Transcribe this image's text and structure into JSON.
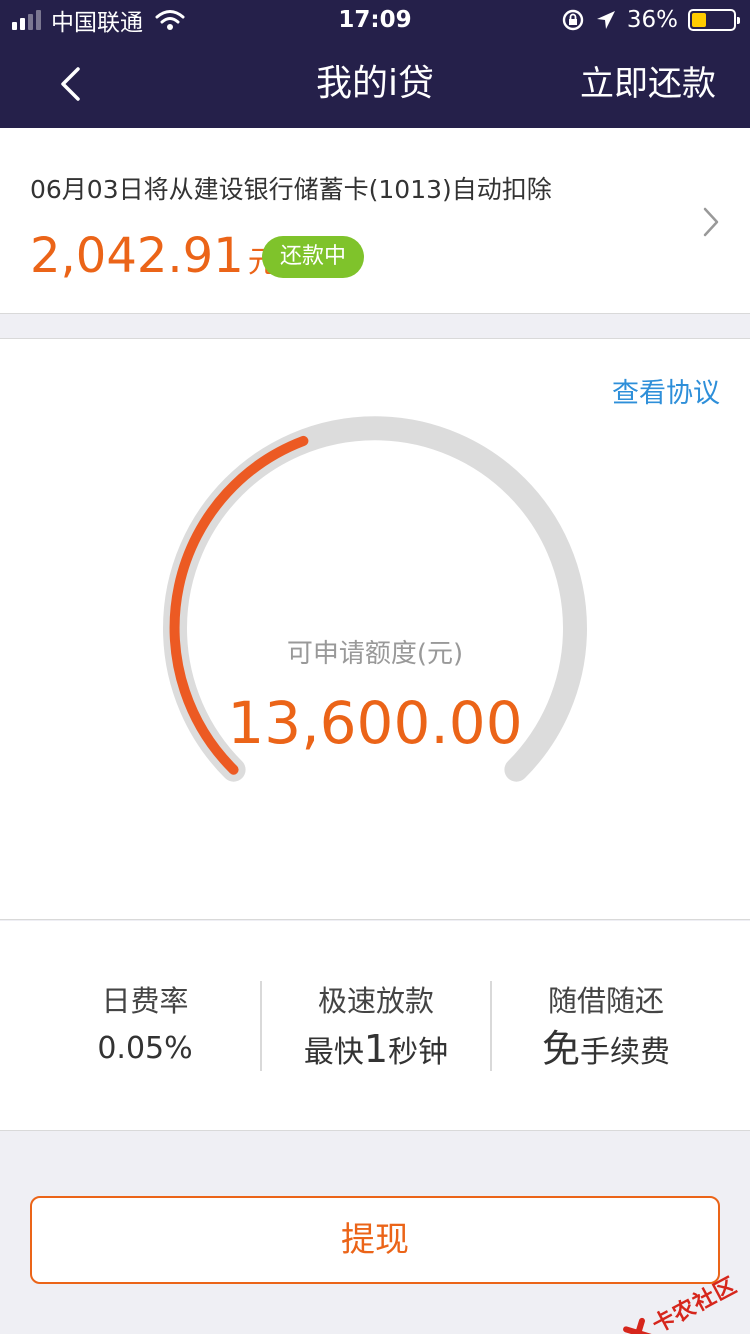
{
  "status_bar": {
    "carrier": "中国联通",
    "time": "17:09",
    "battery": "36%",
    "battery_level": 0.36
  },
  "nav": {
    "title": "我的i贷",
    "action": "立即还款"
  },
  "repayment": {
    "notice": "06月03日将从建设银行储蓄卡(1013)自动扣除",
    "amount": "2,042.91",
    "unit": "元",
    "status": "还款中"
  },
  "credit": {
    "agreement_link": "查看协议",
    "caption": "可申请额度(元)",
    "amount": "13,600.00"
  },
  "features": [
    {
      "label": "日费率",
      "value": "0.05%"
    },
    {
      "label": "极速放款",
      "value_prefix": "最快",
      "value_emph": "1",
      "value_suffix": "秒钟"
    },
    {
      "label": "随借随还",
      "value_emph": "免",
      "value_suffix": "手续费"
    }
  ],
  "withdraw_button": "提现",
  "watermark": "卡农社区",
  "colors": {
    "nav_bg": "#25204a",
    "accent_orange": "#eb6418",
    "badge_green": "#7fc32b",
    "link_blue": "#2e8fd9"
  }
}
